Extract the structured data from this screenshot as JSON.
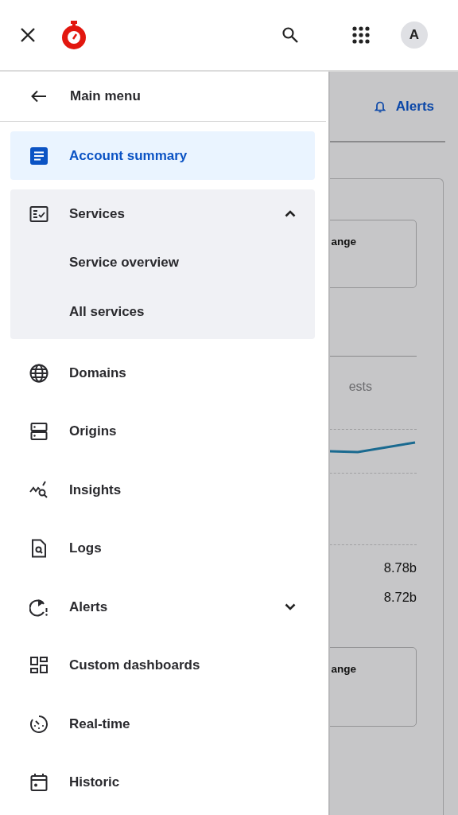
{
  "header": {
    "avatar": "A"
  },
  "drawer": {
    "back_label": "Main menu",
    "items": [
      {
        "kind": "link",
        "label": "Account summary",
        "selected": true
      },
      {
        "kind": "group",
        "label": "Services",
        "selected": false,
        "expanded": true,
        "children": [
          {
            "label": "Service overview",
            "selected": false
          },
          {
            "label": "All services",
            "selected": false
          }
        ]
      },
      {
        "kind": "link",
        "label": "Domains",
        "selected": false
      },
      {
        "kind": "link",
        "label": "Origins",
        "selected": false
      },
      {
        "kind": "link",
        "label": "Insights",
        "selected": false
      },
      {
        "kind": "link",
        "label": "Logs",
        "selected": false
      },
      {
        "kind": "group",
        "label": "Alerts",
        "selected": false,
        "expanded": false
      },
      {
        "kind": "link",
        "label": "Custom dashboards",
        "selected": false
      },
      {
        "kind": "link",
        "label": "Real-time",
        "selected": false
      },
      {
        "kind": "link",
        "label": "Historic",
        "selected": false
      }
    ]
  },
  "background": {
    "alerts_link": "Alerts",
    "card_button_1": "ange",
    "chart_title": "ests",
    "values": [
      "8.78b",
      "8.72b"
    ],
    "card_button_2": "ange"
  }
}
